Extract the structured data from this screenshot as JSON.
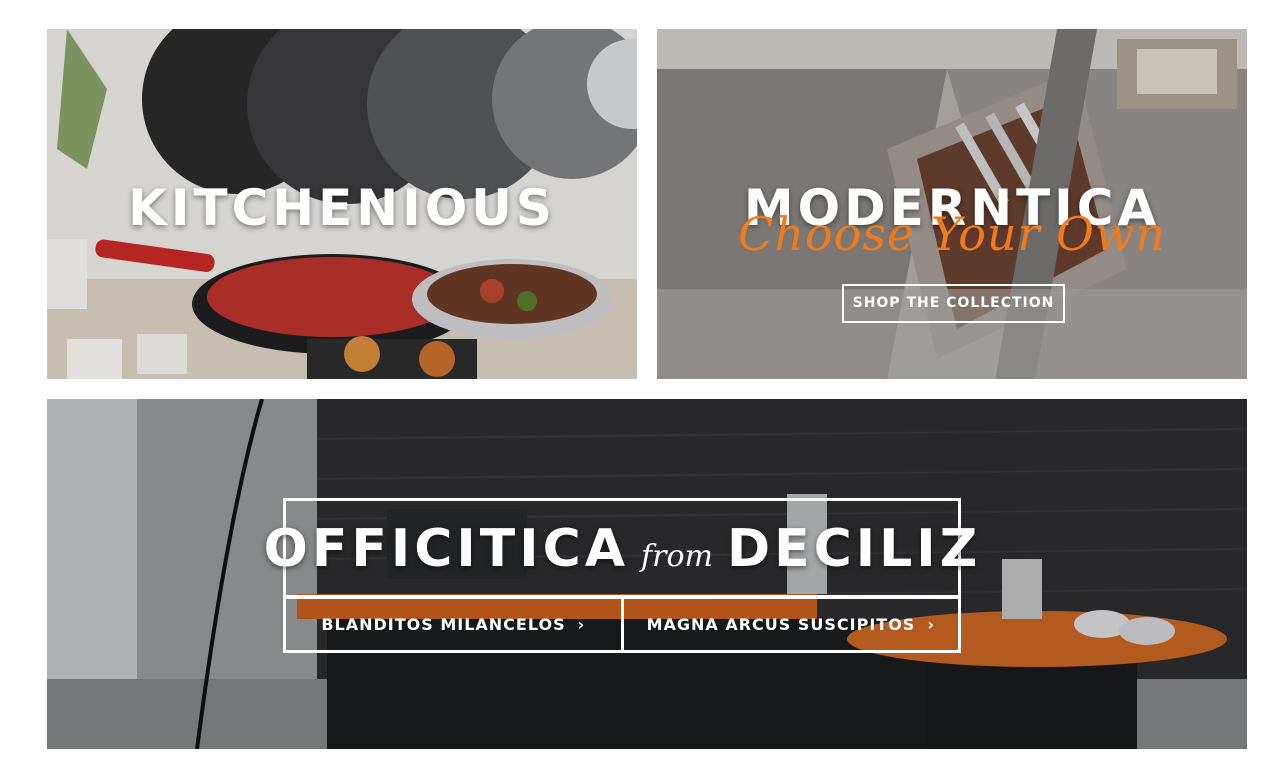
{
  "banners": {
    "kitchen": {
      "title": "KITCHENIOUS"
    },
    "modern": {
      "title": "MODERNTICA",
      "script": "Choose Your Own",
      "button": "SHOP THE COLLECTION"
    },
    "office": {
      "title_left": "OFFICITICA",
      "title_from": "from",
      "title_right": "DECILIZ",
      "link1": "BLANDITOS MILANCELOS",
      "link2": "MAGNA ARCUS SUSCIPITOS",
      "chevron": "›"
    }
  },
  "colors": {
    "accent_script": "#f07a1c",
    "text": "#ffffff"
  },
  "icons": [
    "chevron-right-icon"
  ]
}
